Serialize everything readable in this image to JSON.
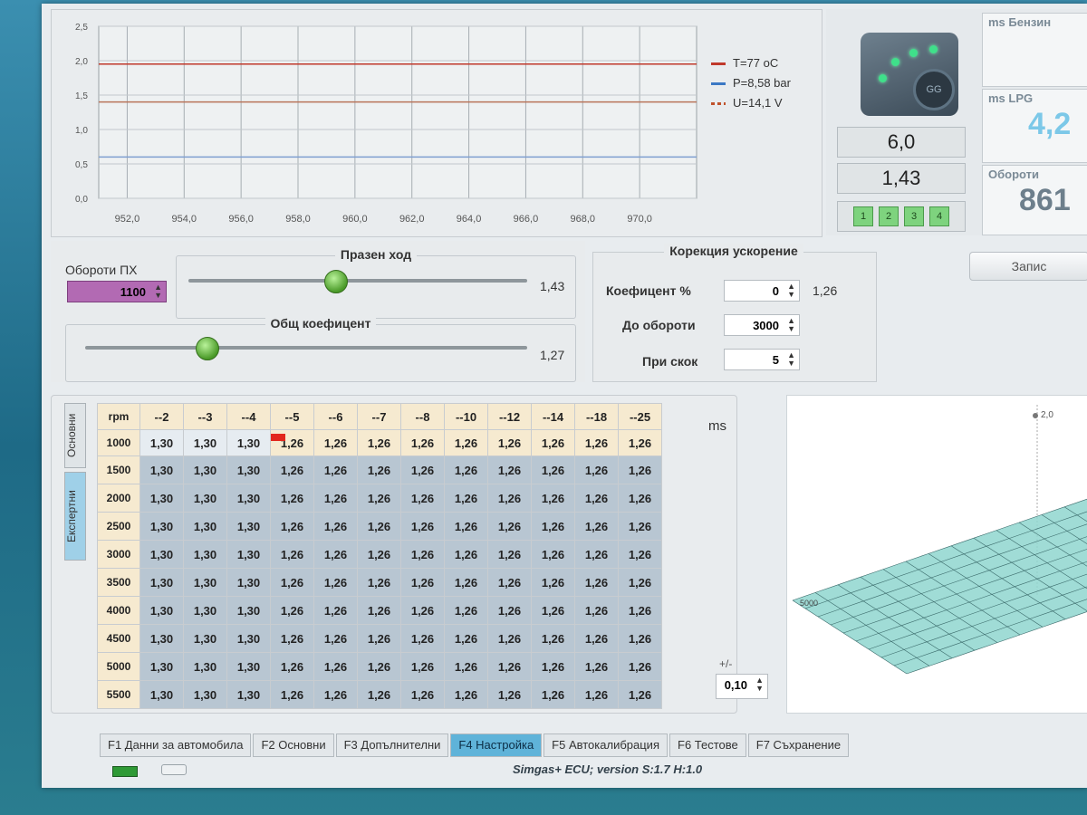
{
  "chart": {
    "legend": [
      {
        "label": "T=77 oC",
        "color": "#c0392b"
      },
      {
        "label": "P=8,58 bar",
        "color": "#3b78c4"
      },
      {
        "label": "U=14,1 V",
        "color": "#c0522b"
      }
    ]
  },
  "chart_data": {
    "type": "line",
    "x_ticks": [
      "952,0",
      "954,0",
      "956,0",
      "958,0",
      "960,0",
      "962,0",
      "964,0",
      "966,0",
      "968,0",
      "970,0"
    ],
    "y_ticks": [
      "0,0",
      "0,5",
      "1,0",
      "1,5",
      "2,0",
      "2,5"
    ],
    "xlim": [
      951,
      972
    ],
    "ylim": [
      0,
      2.5
    ],
    "series": [
      {
        "name": "T=77 oC",
        "color": "#c0392b",
        "y": 1.95
      },
      {
        "name": "P=8,58 bar",
        "color": "#7f9fd0",
        "y": 0.6
      },
      {
        "name": "U=14,1 V",
        "color": "#b8745a",
        "y": 1.4
      }
    ]
  },
  "status": {
    "gauge_label": "GG",
    "value1": "6,0",
    "value2": "1,43",
    "injectors": [
      "1",
      "2",
      "3",
      "4"
    ],
    "card1_label": "ms Бензин",
    "card2_label": "ms LPG",
    "card2_value": "4,2",
    "card3_label": "Обороти",
    "card3_value": "861"
  },
  "idle": {
    "rpm_label": "Обороти ПХ",
    "rpm_value": "1100",
    "group1_title": "Празен ход",
    "slider1_value": "1,43",
    "group2_title": "Общ коефицент",
    "slider2_value": "1,27"
  },
  "accel": {
    "title": "Корекция ускорение",
    "coef_label": "Коефицент %",
    "coef_value": "0",
    "coef_result": "1,26",
    "rpm_label": "До обороти",
    "rpm_value": "3000",
    "jump_label": "При скок",
    "jump_value": "5"
  },
  "save_button": "Запис",
  "map": {
    "vtab1": "Основни",
    "vtab2": "Експертни",
    "corner": "rpm",
    "columns": [
      "--2",
      "--3",
      "--4",
      "--5",
      "--6",
      "--7",
      "--8",
      "--10",
      "--12",
      "--14",
      "--18",
      "--25"
    ],
    "rows": [
      {
        "rpm": "1000",
        "cells": [
          "1,30",
          "1,30",
          "1,30",
          "1,26",
          "1,26",
          "1,26",
          "1,26",
          "1,26",
          "1,26",
          "1,26",
          "1,26",
          "1,26"
        ]
      },
      {
        "rpm": "1500",
        "cells": [
          "1,30",
          "1,30",
          "1,30",
          "1,26",
          "1,26",
          "1,26",
          "1,26",
          "1,26",
          "1,26",
          "1,26",
          "1,26",
          "1,26"
        ]
      },
      {
        "rpm": "2000",
        "cells": [
          "1,30",
          "1,30",
          "1,30",
          "1,26",
          "1,26",
          "1,26",
          "1,26",
          "1,26",
          "1,26",
          "1,26",
          "1,26",
          "1,26"
        ]
      },
      {
        "rpm": "2500",
        "cells": [
          "1,30",
          "1,30",
          "1,30",
          "1,26",
          "1,26",
          "1,26",
          "1,26",
          "1,26",
          "1,26",
          "1,26",
          "1,26",
          "1,26"
        ]
      },
      {
        "rpm": "3000",
        "cells": [
          "1,30",
          "1,30",
          "1,30",
          "1,26",
          "1,26",
          "1,26",
          "1,26",
          "1,26",
          "1,26",
          "1,26",
          "1,26",
          "1,26"
        ]
      },
      {
        "rpm": "3500",
        "cells": [
          "1,30",
          "1,30",
          "1,30",
          "1,26",
          "1,26",
          "1,26",
          "1,26",
          "1,26",
          "1,26",
          "1,26",
          "1,26",
          "1,26"
        ]
      },
      {
        "rpm": "4000",
        "cells": [
          "1,30",
          "1,30",
          "1,30",
          "1,26",
          "1,26",
          "1,26",
          "1,26",
          "1,26",
          "1,26",
          "1,26",
          "1,26",
          "1,26"
        ]
      },
      {
        "rpm": "4500",
        "cells": [
          "1,30",
          "1,30",
          "1,30",
          "1,26",
          "1,26",
          "1,26",
          "1,26",
          "1,26",
          "1,26",
          "1,26",
          "1,26",
          "1,26"
        ]
      },
      {
        "rpm": "5000",
        "cells": [
          "1,30",
          "1,30",
          "1,30",
          "1,26",
          "1,26",
          "1,26",
          "1,26",
          "1,26",
          "1,26",
          "1,26",
          "1,26",
          "1,26"
        ]
      },
      {
        "rpm": "5500",
        "cells": [
          "1,30",
          "1,30",
          "1,30",
          "1,26",
          "1,26",
          "1,26",
          "1,26",
          "1,26",
          "1,26",
          "1,26",
          "1,26",
          "1,26"
        ]
      }
    ],
    "unit": "ms",
    "step_label": "+/-",
    "step_value": "0,10"
  },
  "plot3d": {
    "z_label": "2,0",
    "axis_label": "5000"
  },
  "tabs": [
    "F1 Данни за автомобила",
    "F2 Основни",
    "F3 Допълнителни",
    "F4 Настройка",
    "F5 Автокалибрация",
    "F6 Тестове",
    "F7 Съхранение"
  ],
  "active_tab_index": 3,
  "version": "Simgas+ ECU; version S:1.7 H:1.0"
}
